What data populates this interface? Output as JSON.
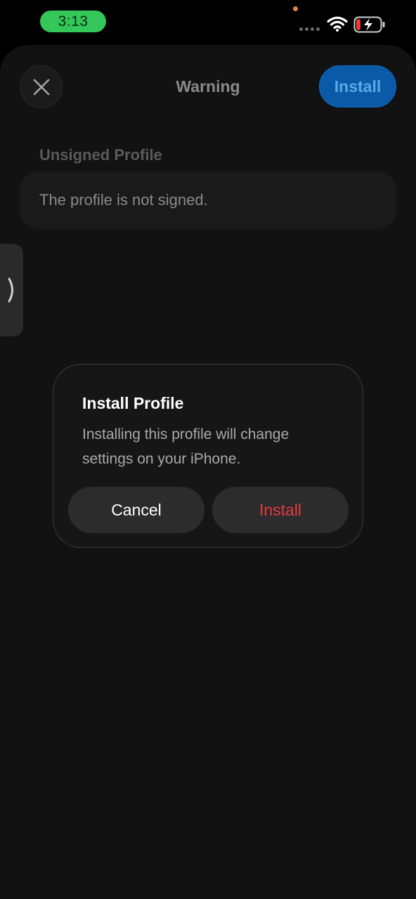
{
  "status_bar": {
    "time": "3:13",
    "icons": [
      "signal-dots-icon",
      "wifi-icon",
      "battery-charging-icon"
    ],
    "colors": {
      "time_pill": "#34c759",
      "battery_low": "#e8393d"
    }
  },
  "nav": {
    "close_icon": "close-icon",
    "title": "Warning",
    "install_label": "Install"
  },
  "profile": {
    "section_header": "Unsigned Profile",
    "message": "The profile is not signed."
  },
  "side_tab": {
    "icon": "chevron-right-icon"
  },
  "alert": {
    "title": "Install Profile",
    "message": "Installing this profile will change settings on your iPhone.",
    "cancel_label": "Cancel",
    "install_label": "Install",
    "colors": {
      "destructive": "#e8393d"
    }
  }
}
